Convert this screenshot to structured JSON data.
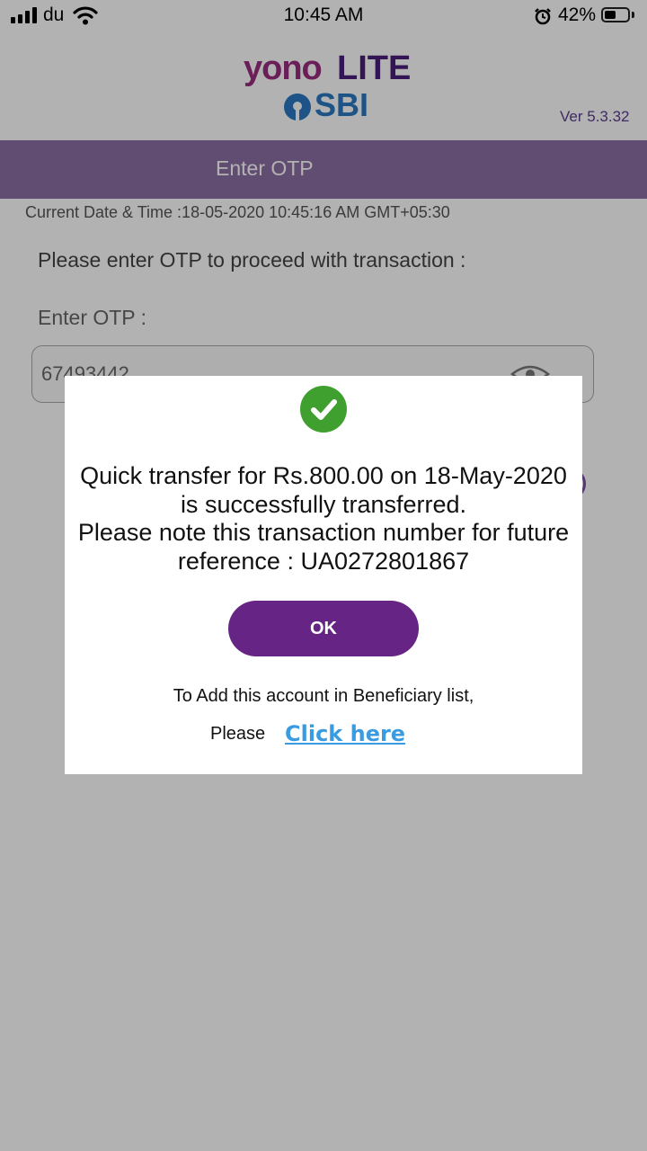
{
  "status_bar": {
    "carrier": "du",
    "time": "10:45 AM",
    "battery_percent": "42%"
  },
  "header": {
    "logo_yono": "yono",
    "logo_lite": "LITE",
    "logo_sbi": "SBI",
    "version": "Ver 5.3.32"
  },
  "page": {
    "title": "Enter OTP",
    "datetime": "Current Date & Time :18-05-2020 10:45:16 AM GMT+05:30",
    "prompt": "Please enter OTP to proceed with transaction :",
    "otp_label": "Enter OTP :",
    "otp_value": "67493442"
  },
  "dialog": {
    "message_line1": "Quick transfer for Rs.800.00 on 18-May-2020",
    "message_line2": "is successfully transferred.",
    "message_line3": "Please note this transaction number for future",
    "message_line4": "reference : UA0272801867",
    "ok_label": "OK",
    "beneficiary_text": "To Add this account in Beneficiary list,",
    "please_text": "Please",
    "click_here": "Click here"
  },
  "colors": {
    "title_bar": "#8d6fa4",
    "ok_button": "#662484",
    "success_icon": "#3fa02f",
    "link": "#3a9be0"
  },
  "icons": {
    "success": "check-circle-icon",
    "password_toggle": "eye-icon",
    "signal": "signal-icon",
    "wifi": "wifi-icon",
    "alarm": "alarm-icon",
    "battery": "battery-icon"
  }
}
